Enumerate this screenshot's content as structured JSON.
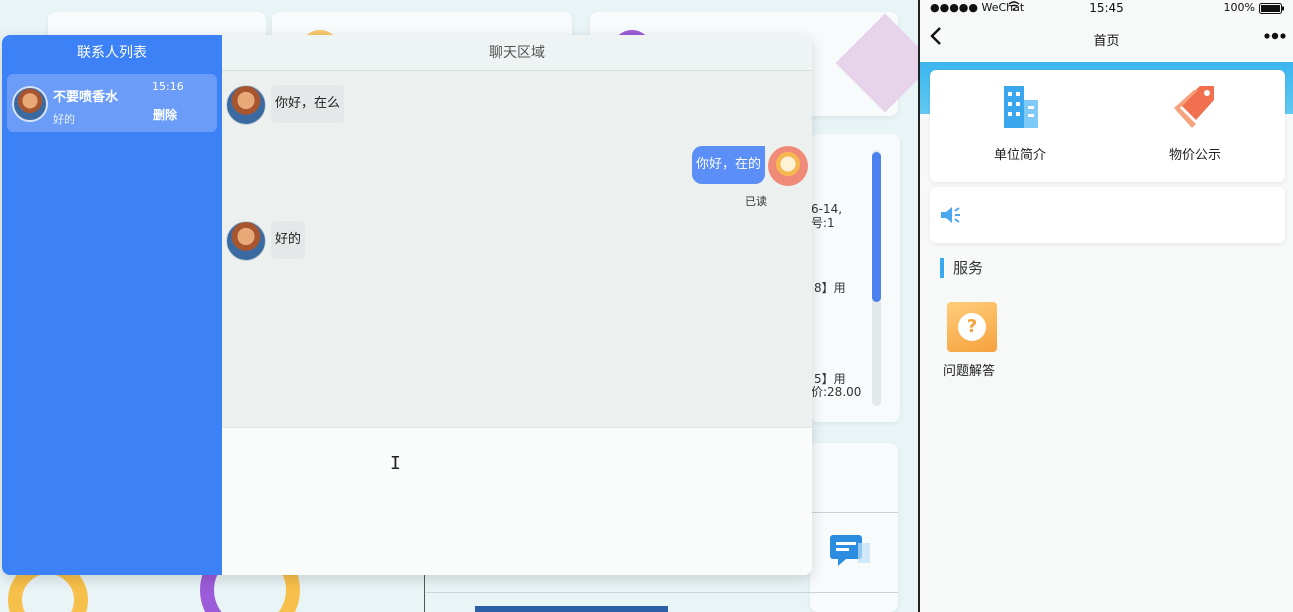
{
  "background": {
    "snippets": [
      "6-14,",
      "号:1",
      "8】用",
      "5】用",
      "价:28.00"
    ]
  },
  "contacts": {
    "title": "联系人列表",
    "items": [
      {
        "name": "不要喷香水",
        "time": "15:16",
        "last_message": "好的",
        "delete_label": "删除"
      }
    ]
  },
  "chat": {
    "title": "聊天区域",
    "messages": [
      {
        "from": "other",
        "text": "你好，在么"
      },
      {
        "from": "self",
        "text": "你好，在的",
        "status": "已读"
      },
      {
        "from": "other",
        "text": "好的"
      }
    ],
    "input_value": ""
  },
  "phone": {
    "status_bar": {
      "carrier": "●●●●● WeChat",
      "time": "15:45",
      "battery": "100%"
    },
    "nav_title": "首页",
    "grid": [
      {
        "label": "单位简介",
        "icon": "building-icon"
      },
      {
        "label": "物价公示",
        "icon": "price-tag-icon"
      }
    ],
    "notice_icon": "speaker-icon",
    "section_title": "服务",
    "services": [
      {
        "label": "问题解答",
        "icon": "question-icon"
      }
    ]
  },
  "colors": {
    "contacts_bg": "#3c82f6",
    "self_bubble": "#5b8ef7",
    "phone_banner": "#3ab6ee"
  }
}
